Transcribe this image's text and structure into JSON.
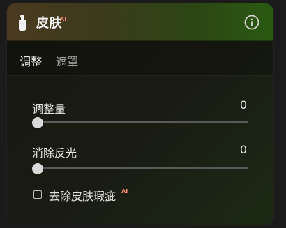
{
  "header": {
    "title": "皮肤",
    "ai_badge": "AI",
    "icons": [
      "bottle-icon",
      "info-icon"
    ]
  },
  "tabs": [
    {
      "label": "调整",
      "active": true
    },
    {
      "label": "遮罩",
      "active": false
    }
  ],
  "sliders": [
    {
      "label": "调整量",
      "value_text": "0",
      "value": 0
    },
    {
      "label": "消除反光",
      "value_text": "0",
      "value": 0
    }
  ],
  "checkbox": {
    "label": "去除皮肤瑕疵",
    "ai_badge": "AI",
    "checked": false
  },
  "colors": {
    "ai_badge": "#ff8a74",
    "header_gradient_left": "#4a3a20",
    "header_gradient_right": "#2a5a12"
  }
}
